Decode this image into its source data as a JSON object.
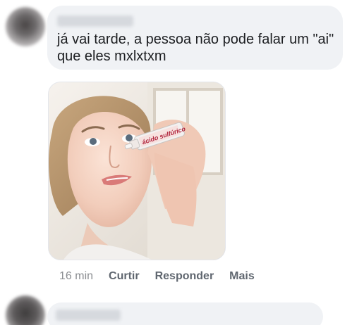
{
  "comment": {
    "text": "já vai tarde, a pessoa não pode falar um \"ai\"\nque eles mxlxtxm",
    "image": {
      "bottle_label": "ácido sulfúrico"
    },
    "time": "16 min",
    "actions": {
      "like": "Curtir",
      "reply": "Responder",
      "more": "Mais"
    }
  },
  "colors": {
    "bubble_bg": "#f0f2f5",
    "text": "#1c1e21",
    "meta": "#65676b"
  }
}
